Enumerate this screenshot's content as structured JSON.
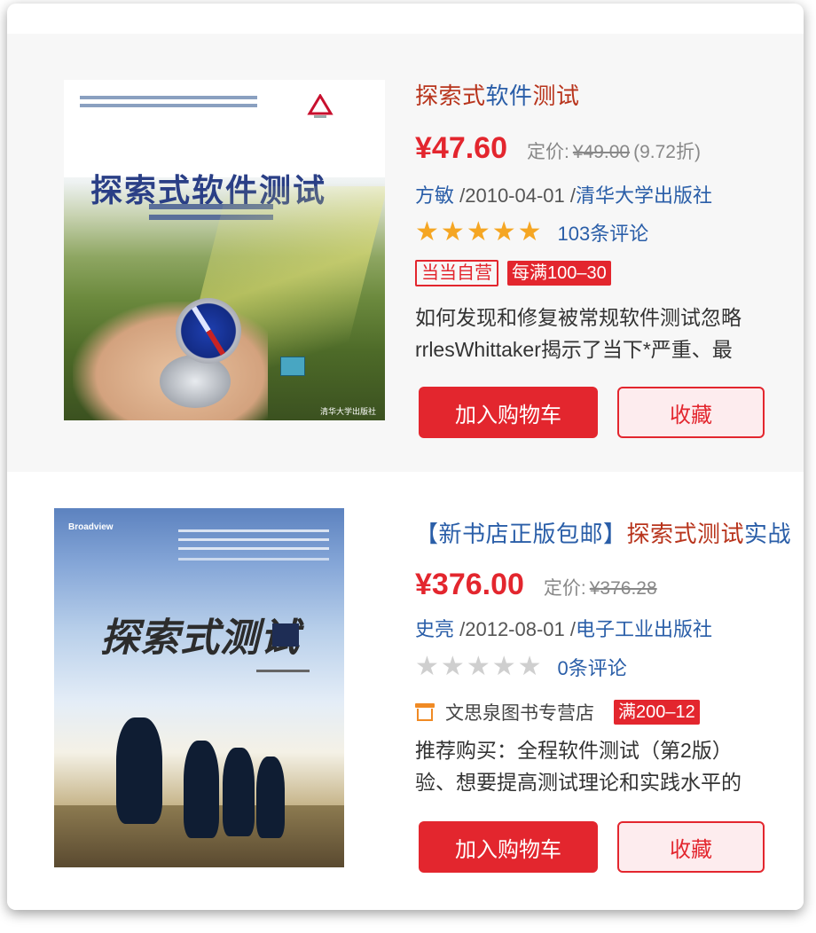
{
  "products": [
    {
      "title_parts": [
        {
          "text": "探索式",
          "color": "red"
        },
        {
          "text": "软件",
          "color": "blue"
        },
        {
          "text": "测试",
          "color": "red"
        }
      ],
      "price": "¥47.60",
      "orig_label": "定价:",
      "orig_price": "¥49.00",
      "discount": "(9.72折)",
      "author": "方敏",
      "date": " /2010-04-01 /",
      "publisher": "清华大学出版社",
      "stars_on": 5,
      "reviews": "103条评论",
      "tag_outline": "当当自营",
      "tag_fill": "每满100–30",
      "desc_lines": [
        "如何发现和修复被常规软件测试忽略",
        "rrlesWhittaker揭示了当下*严重、最"
      ],
      "cart_label": "加入购物车",
      "fav_label": "收藏",
      "cover": {
        "title": "探索式软件测试",
        "publisher": "清华大学出版社"
      }
    },
    {
      "title_parts": [
        {
          "text": "【新书店正版包邮】",
          "color": "blue"
        },
        {
          "text": "探索式测试",
          "color": "red"
        },
        {
          "text": "实战",
          "color": "blue"
        }
      ],
      "price": "¥376.00",
      "orig_label": "定价:",
      "orig_price": "¥376.28",
      "discount": "",
      "author": "史亮",
      "date": " /2012-08-01 /",
      "publisher": "电子工业出版社",
      "stars_on": 0,
      "reviews": "0条评论",
      "shop_name": "文思泉图书专营店",
      "tag_fill": "满200–12",
      "desc_lines": [
        "推荐购买：全程软件测试（第2版）",
        "验、想要提高测试理论和实践水平的"
      ],
      "cart_label": "加入购物车",
      "fav_label": "收藏",
      "cover": {
        "title": "探索式测试"
      }
    }
  ],
  "colors": {
    "accent": "#e3262e",
    "link": "#2a5ea8",
    "title_red": "#b8341c",
    "star": "#f5a623"
  }
}
